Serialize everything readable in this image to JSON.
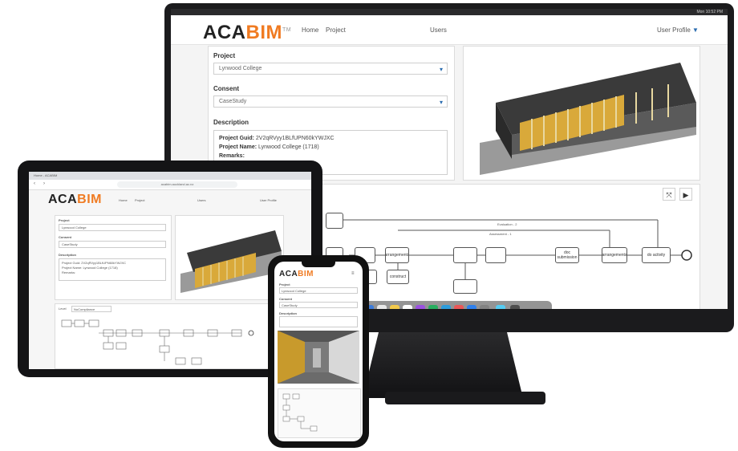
{
  "brand": {
    "logo_dark": "ACA",
    "logo_accent": "BIM",
    "logo_tm": "TM",
    "accent_color": "#f07b22"
  },
  "desktop": {
    "menubar_time": "Mon 10:52 PM",
    "nav": {
      "home": "Home",
      "project": "Project",
      "users": "Users",
      "user_profile": "User Profile"
    },
    "form": {
      "project_label": "Project",
      "project_value": "Lynwood College",
      "consent_label": "Consent",
      "consent_value": "CaseStudy",
      "description_label": "Description",
      "guid_label": "Project Guid:",
      "guid_value": "2V2qRVyy1BLfUPN60kYWJXC",
      "name_label": "Project Name:",
      "name_value": "Lynwood College (1718)",
      "remarks_label": "Remarks:"
    },
    "toolbar": {
      "expand_icon": "expand-icon",
      "play_icon": "play-icon"
    },
    "workflow": {
      "tasks": [
        "",
        "",
        "",
        "arrangements",
        "construct",
        "",
        "",
        "",
        "",
        "doc submission",
        "arrangements",
        "do activity"
      ],
      "gateway_labels": [
        "Evaluation - 2",
        "Assessment - 1"
      ]
    }
  },
  "tablet": {
    "status_time": "10:52 AM",
    "tab_title": "Home - ACABIM",
    "url": "acabim.auckland.ac.nz",
    "nav": {
      "home": "Home",
      "project": "Project",
      "users": "Users",
      "user_profile": "User Profile"
    },
    "form": {
      "project_label": "Project",
      "project_value": "Lynwood College",
      "consent_label": "Consent",
      "consent_value": "CaseStudy",
      "description_label": "Description",
      "guid_line": "Project Guid: 2V2qRVyy1BLfUPN60kYWJXC",
      "name_line": "Project Name: Lynwood College (1718)",
      "remarks_line": "Remarks:"
    },
    "workflow_label": "Level",
    "workflow_select": "NoCompliance"
  },
  "phone": {
    "project_label": "Project",
    "project_value": "Lynwood College",
    "consent_label": "Consent",
    "consent_value": "CaseStudy",
    "description_label": "Description"
  }
}
